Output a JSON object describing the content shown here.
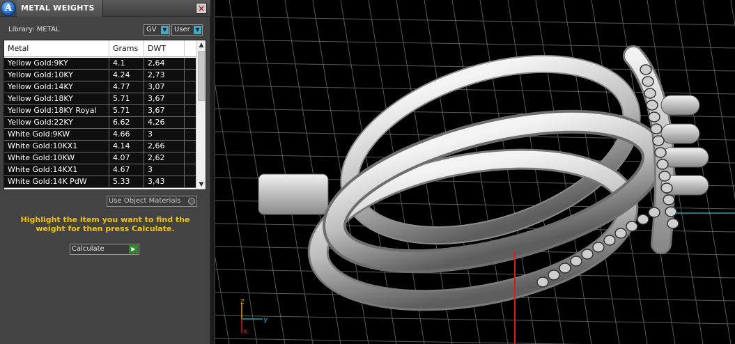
{
  "window": {
    "title": "METAL WEIGHTS",
    "close_label": "×"
  },
  "library": {
    "label": "Library: METAL",
    "dropdown_gv": "GV",
    "dropdown_user": "User"
  },
  "table": {
    "columns": [
      "Metal",
      "Grams",
      "DWT"
    ],
    "rows": [
      {
        "metal": "Yellow Gold:9KY",
        "grams": "4.1",
        "dwt": "2,64"
      },
      {
        "metal": "Yellow Gold:10KY",
        "grams": "4.24",
        "dwt": "2,73"
      },
      {
        "metal": "Yellow Gold:14KY",
        "grams": "4.77",
        "dwt": "3,07"
      },
      {
        "metal": "Yellow Gold:18KY",
        "grams": "5.71",
        "dwt": "3,67"
      },
      {
        "metal": "Yellow Gold:18KY Royal",
        "grams": "5.71",
        "dwt": "3,67"
      },
      {
        "metal": "Yellow Gold:22KY",
        "grams": "6.62",
        "dwt": "4,26"
      },
      {
        "metal": "White Gold:9KW",
        "grams": "4.66",
        "dwt": "3"
      },
      {
        "metal": "White Gold:10KX1",
        "grams": "4.14",
        "dwt": "2,66"
      },
      {
        "metal": "White Gold:10KW",
        "grams": "4.07",
        "dwt": "2,62"
      },
      {
        "metal": "White Gold:14KX1",
        "grams": "4.67",
        "dwt": "3"
      },
      {
        "metal": "White Gold:14K PdW",
        "grams": "5.33",
        "dwt": "3,43"
      }
    ]
  },
  "options": {
    "use_object_materials": "Use Object Materials"
  },
  "hint": "Highlight the item you want to find the weight for then press Calculate.",
  "calculate": {
    "label": "Calculate"
  },
  "viewport": {
    "axis_labels": {
      "z": "z",
      "y": "y",
      "x": "x"
    },
    "colors": {
      "background": "#000000",
      "grid": "#5a5a5a",
      "ring": "#d9d9d9",
      "axis_x": "#d02020",
      "axis_y": "#20a0b0",
      "axis_z": "#d4a020"
    }
  },
  "colors": {
    "panel_bg": "#434343",
    "hint_text": "#f0c419",
    "selected_row_bg": "#0f0f0f"
  }
}
